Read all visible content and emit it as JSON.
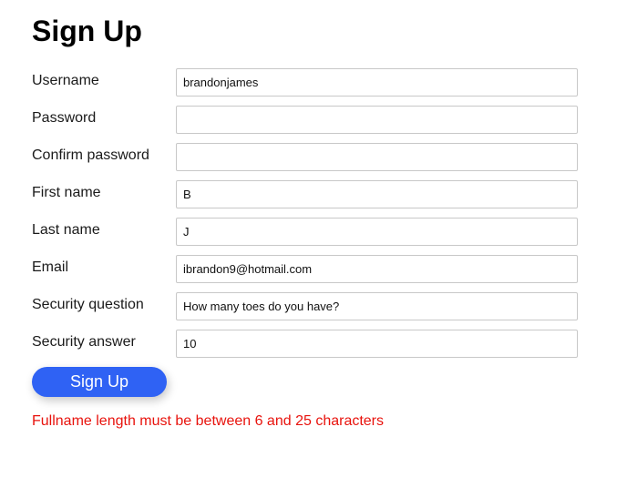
{
  "page": {
    "title": "Sign Up"
  },
  "form": {
    "fields": [
      {
        "label": "Username",
        "value": "brandonjames"
      },
      {
        "label": "Password",
        "value": ""
      },
      {
        "label": "Confirm password",
        "value": ""
      },
      {
        "label": "First name",
        "value": "B"
      },
      {
        "label": "Last name",
        "value": "J"
      },
      {
        "label": "Email",
        "value": "ibrandon9@hotmail.com"
      },
      {
        "label": "Security question",
        "value": "How many toes do you have?"
      },
      {
        "label": "Security answer",
        "value": "10"
      }
    ],
    "submit_label": "Sign Up",
    "error": "Fullname length must be between 6 and 25 characters"
  },
  "colors": {
    "accent": "#2f62f4",
    "error": "#e8130d"
  }
}
